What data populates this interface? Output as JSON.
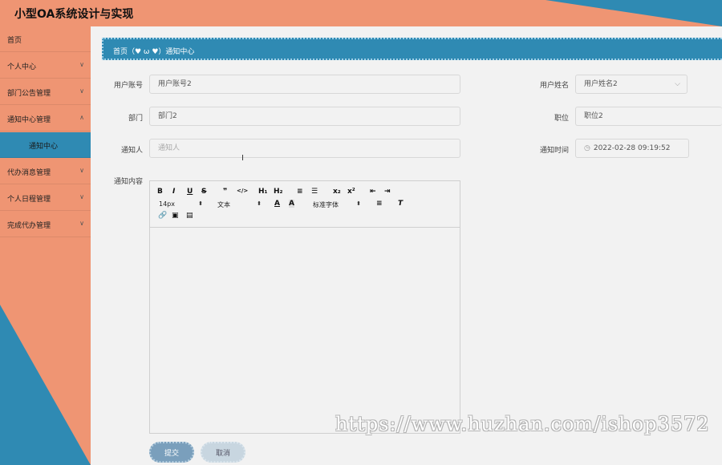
{
  "app": {
    "title": "小型OA系统设计与实现"
  },
  "sidebar": {
    "items": [
      {
        "label": "首页",
        "chevron": ""
      },
      {
        "label": "个人中心",
        "chevron": "∨"
      },
      {
        "label": "部门公告管理",
        "chevron": "∨"
      },
      {
        "label": "通知中心管理",
        "chevron": "∧"
      },
      {
        "label": "通知中心",
        "chevron": ""
      },
      {
        "label": "代办消息管理",
        "chevron": "∨"
      },
      {
        "label": "个人日程管理",
        "chevron": "∨"
      },
      {
        "label": "完成代办管理",
        "chevron": "∨"
      }
    ]
  },
  "breadcrumb": {
    "text": "首页（♥ ω ♥）通知中心"
  },
  "form": {
    "account": {
      "label": "用户账号",
      "value": "用户账号2"
    },
    "name": {
      "label": "用户姓名",
      "value": "用户姓名2"
    },
    "dept": {
      "label": "部门",
      "value": "部门2"
    },
    "position": {
      "label": "职位",
      "value": "职位2"
    },
    "notifier": {
      "label": "通知人",
      "placeholder": "通知人"
    },
    "time": {
      "label": "通知时间",
      "value": "2022-02-28 09:19:52"
    },
    "content": {
      "label": "通知内容"
    }
  },
  "editor": {
    "toolbar_row1": [
      "B",
      "I",
      "U",
      "S",
      "❞",
      "</>",
      "H₁",
      "H₂",
      "≡",
      "☰",
      "x₂",
      "x²",
      "⇤",
      "⇥"
    ],
    "font_size": "14px",
    "text_type": "文本",
    "font_family": "标准字体"
  },
  "buttons": {
    "submit": "提交",
    "cancel": "取消"
  },
  "watermark": "https://www.huzhan.com/ishop3572",
  "colors": {
    "accent_orange": "#ef9573",
    "accent_teal": "#2f8ab3"
  }
}
